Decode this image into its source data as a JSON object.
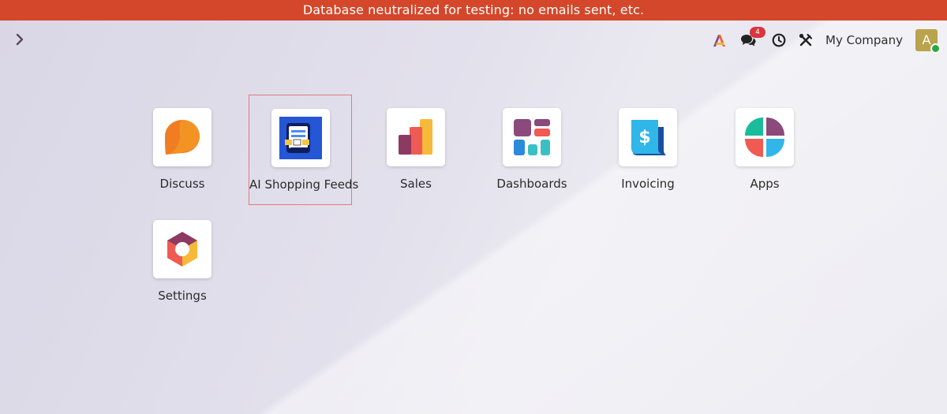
{
  "banner": {
    "text": "Database neutralized for testing: no emails sent, etc.",
    "color": "#d4472a"
  },
  "navbar": {
    "menu_toggle_icon": "chevron-right-icon",
    "systray": {
      "activity_icon": "odoo-ai-icon",
      "messages_icon": "chat-bubbles-icon",
      "messages_count": "4",
      "clock_icon": "clock-icon",
      "tools_icon": "wrench-screwdriver-icon",
      "company": "My Company",
      "user_initial": "A"
    }
  },
  "apps": [
    {
      "label": "Discuss",
      "icon": "discuss-icon"
    },
    {
      "label": "AI Shopping Feeds",
      "icon": "ai-shopping-feeds-icon",
      "selected": true
    },
    {
      "label": "Sales",
      "icon": "sales-icon"
    },
    {
      "label": "Dashboards",
      "icon": "dashboards-icon"
    },
    {
      "label": "Invoicing",
      "icon": "invoicing-icon"
    },
    {
      "label": "Apps",
      "icon": "apps-icon"
    },
    {
      "label": "Settings",
      "icon": "settings-icon"
    }
  ]
}
